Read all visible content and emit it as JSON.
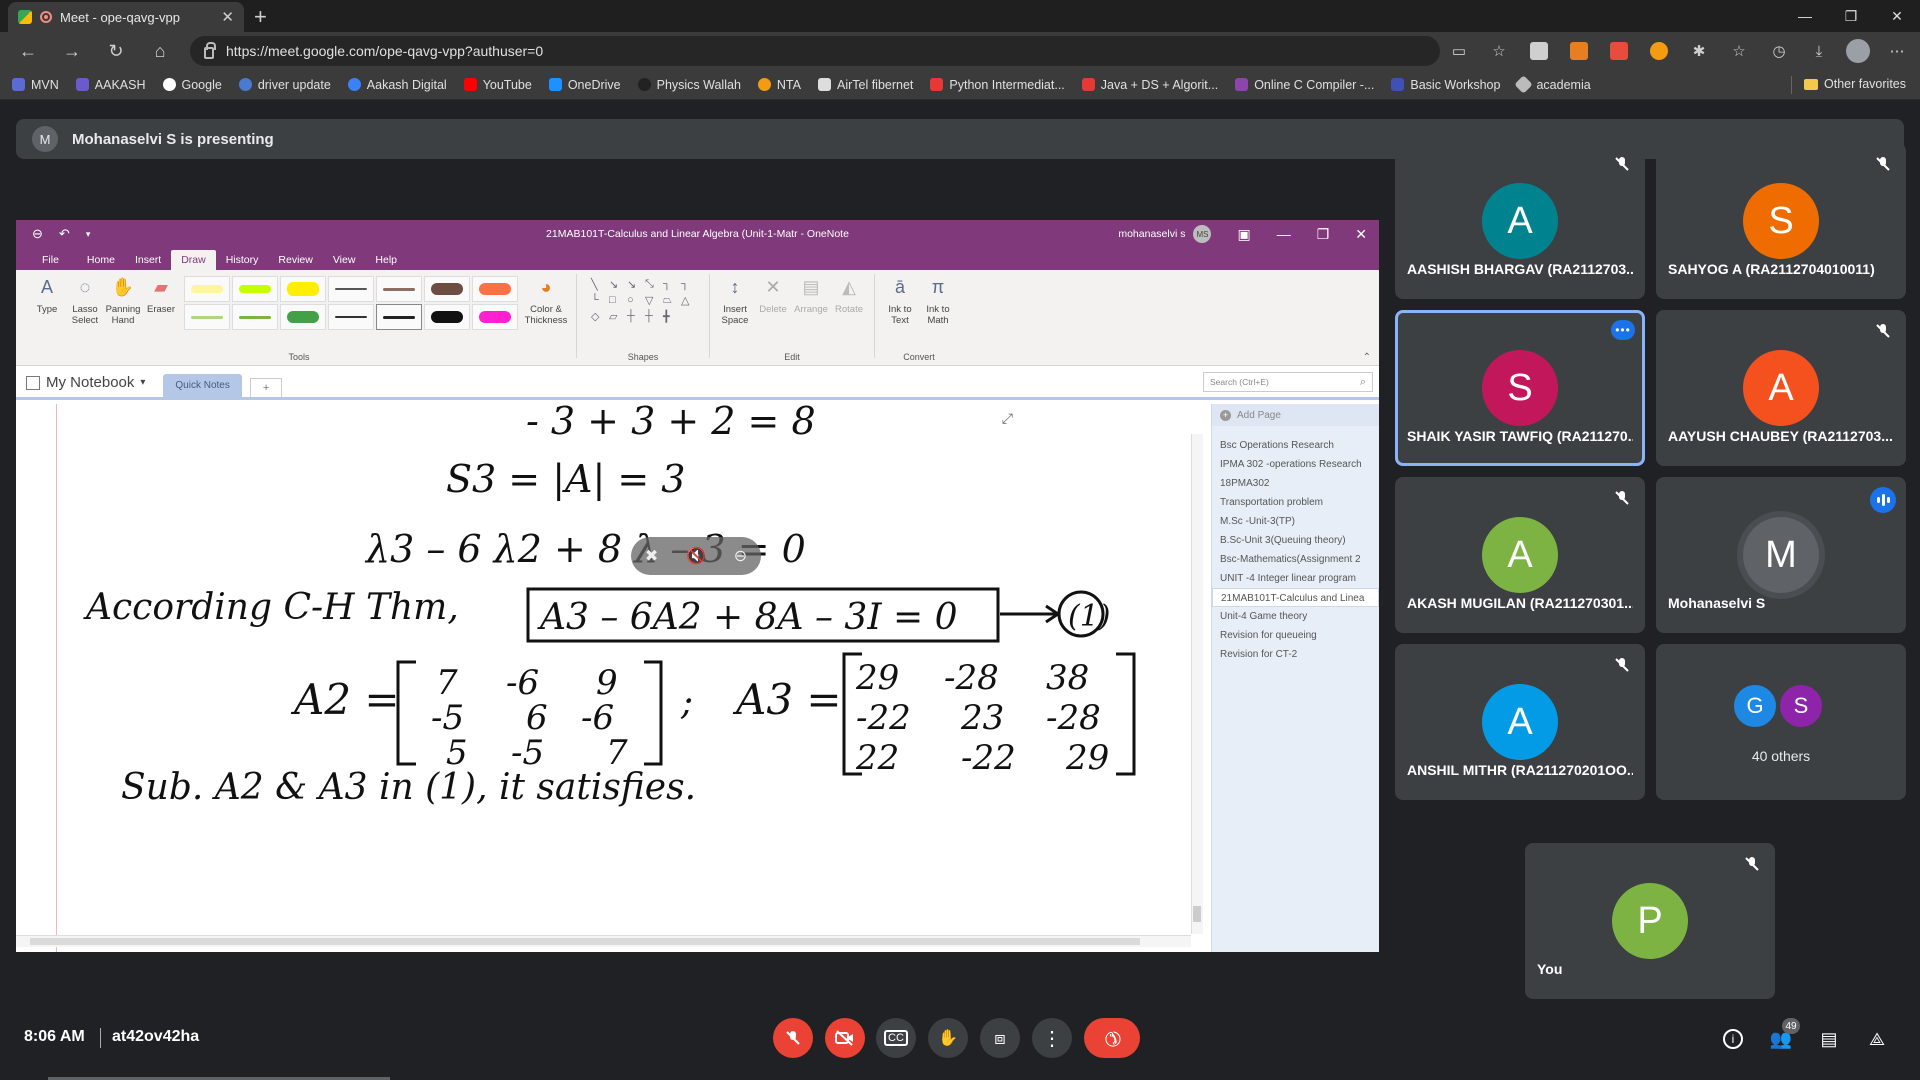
{
  "browser": {
    "tab_title": "Meet - ope-qavg-vpp",
    "url": "https://meet.google.com/ope-qavg-vpp?authuser=0",
    "bookmarks": [
      {
        "label": "MVN",
        "color": "#5b6bd6"
      },
      {
        "label": "AAKASH",
        "color": "#6a5acd"
      },
      {
        "label": "Google",
        "color": "#ffffff"
      },
      {
        "label": "driver update",
        "color": "#4a7bd0"
      },
      {
        "label": "Aakash Digital",
        "color": "#3b82f6"
      },
      {
        "label": "YouTube",
        "color": "#ff0000"
      },
      {
        "label": "OneDrive",
        "color": "#1e90ff"
      },
      {
        "label": "Physics Wallah",
        "color": "#222222"
      },
      {
        "label": "NTA",
        "color": "#f39c12"
      },
      {
        "label": "AirTel fibernet",
        "color": "#dddddd"
      },
      {
        "label": "Python Intermediat...",
        "color": "#e53935"
      },
      {
        "label": "Java + DS + Algorit...",
        "color": "#e53935"
      },
      {
        "label": "Online C Compiler -...",
        "color": "#8e44ad"
      },
      {
        "label": "Basic Workshop",
        "color": "#3f51b5"
      },
      {
        "label": "academia",
        "color": "#bbbbbb"
      }
    ],
    "other_favorites": "Other favorites"
  },
  "meet": {
    "presenting_initial": "M",
    "presenting_text": "Mohanaselvi S is presenting",
    "time": "8:06 AM",
    "meeting_id": "at42ov42ha",
    "participant_count": "49",
    "accent": "#8ab4f8",
    "end_call_color": "#ea4335"
  },
  "onenote": {
    "title": "21MAB101T-Calculus and Linear Algebra (Unit-1-Matr  -  OneNote",
    "user": "mohanaselvi s",
    "user_initials": "MS",
    "menu": [
      "File",
      "Home",
      "Insert",
      "Draw",
      "History",
      "Review",
      "View",
      "Help"
    ],
    "active_menu": "Draw",
    "tools": {
      "type": "Type",
      "lasso": "Lasso Select",
      "panning": "Panning Hand",
      "eraser": "Eraser",
      "color_thickness": "Color & Thickness",
      "group_tools": "Tools",
      "group_shapes": "Shapes",
      "insert_space": "Insert Space",
      "delete": "Delete",
      "arrange": "Arrange",
      "rotate": "Rotate",
      "group_edit": "Edit",
      "ink_to_text": "Ink to Text",
      "ink_to_math": "Ink to Math",
      "group_convert": "Convert"
    },
    "notebook": "My Notebook",
    "section": "Quick Notes",
    "add_tab": "+",
    "search_placeholder": "Search (Ctrl+E)",
    "add_page": "Add Page",
    "pages": [
      "Bsc Operations Research",
      "IPMA 302 -operations Research",
      "18PMA302",
      "Transportation problem",
      "M.Sc -Unit-3(TP)",
      "B.Sc-Unit 3(Queuing theory)",
      "Bsc-Mathematics(Assignment 2",
      "UNIT -4 Integer linear program",
      "21MAB101T-Calculus and Linea",
      "Unit-4 Game theory",
      "Revision for queueing",
      "Revision for CT-2"
    ],
    "selected_page_index": 8,
    "ink_lines": [
      "- 3 + 3 + 2   = 8",
      "S3 = |A| = 3",
      "λ3 – 6 λ2 + 8 λ – 3 = 0",
      "According C-H Thm,",
      "A3 – 6A2 + 8A – 3I = 0",
      "(1)",
      "A2 =",
      "A3 =",
      "Sub. A2 & A3 in (1), it satisfies."
    ],
    "matrix_a2": [
      [
        "7",
        "-6",
        "9"
      ],
      [
        "-5",
        "6",
        "-6"
      ],
      [
        "5",
        "-5",
        "7"
      ]
    ],
    "matrix_a3": [
      [
        "29",
        "-28",
        "38"
      ],
      [
        "-22",
        "23",
        "-28"
      ],
      [
        "22",
        "-22",
        "29"
      ]
    ]
  },
  "participants": [
    {
      "initial": "A",
      "name": "AASHISH BHARGAV (RA2112703...",
      "color": "#00838f"
    },
    {
      "initial": "S",
      "name": "SAHYOG A (RA2112704010011)",
      "color": "#ef6c00"
    },
    {
      "initial": "S",
      "name": "SHAIK YASIR TAWFIQ (RA211270...",
      "color": "#c2185b"
    },
    {
      "initial": "A",
      "name": "AAYUSH CHAUBEY (RA2112703...",
      "color": "#f4511e"
    },
    {
      "initial": "A",
      "name": "AKASH MUGILAN (RA211270301...",
      "color": "#7cb342"
    },
    {
      "initial": "M",
      "name": "Mohanaselvi S",
      "color": "#5f6368"
    },
    {
      "initial": "A",
      "name": "ANSHIL MITHR (RA211270201OO...",
      "color": "#039be5"
    },
    {
      "initial": "P",
      "name": "You",
      "color": "#7cb342"
    }
  ],
  "others": {
    "initial1": "G",
    "color1": "#1e88e5",
    "initial2": "S",
    "color2": "#8e24aa",
    "label": "40 others"
  }
}
